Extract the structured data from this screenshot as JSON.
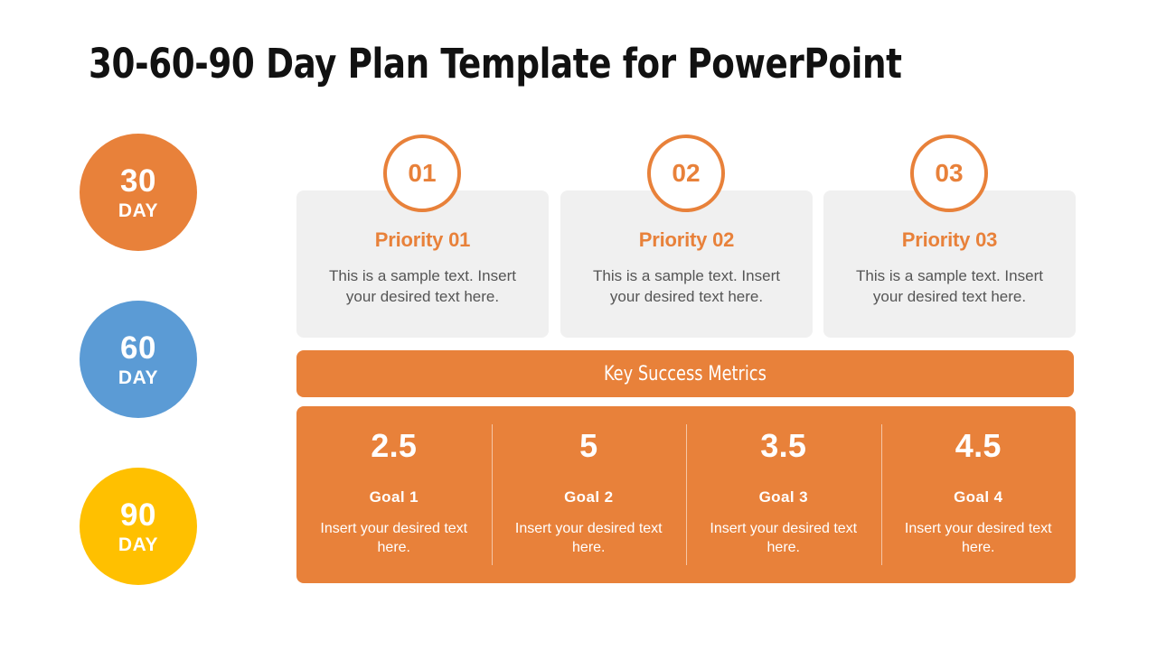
{
  "slide": {
    "title": "30-60-90 Day Plan Template for PowerPoint",
    "background_color": "#FFFFFF"
  },
  "colors": {
    "orange": "#E8813A",
    "blue": "#5B9BD5",
    "yellow": "#FFC000",
    "card_gray": "#F0F0F0",
    "body_text": "#555555",
    "title_text": "#111111"
  },
  "day_circles": [
    {
      "number": "30",
      "unit": "DAY",
      "color": "#E8813A"
    },
    {
      "number": "60",
      "unit": "DAY",
      "color": "#5B9BD5"
    },
    {
      "number": "90",
      "unit": "DAY",
      "color": "#FFC000"
    }
  ],
  "priorities": [
    {
      "badge": "01",
      "title": "Priority 01",
      "description": "This is a sample text. Insert your desired text here."
    },
    {
      "badge": "02",
      "title": "Priority 02",
      "description": "This is a sample text. Insert your desired text here."
    },
    {
      "badge": "03",
      "title": "Priority 03",
      "description": "This is a sample text. Insert your desired text here."
    }
  ],
  "metrics": {
    "header": "Key Success Metrics",
    "goals": [
      {
        "value": "2.5",
        "label": "Goal  1",
        "description": "Insert your desired text here."
      },
      {
        "value": "5",
        "label": "Goal  2",
        "description": "Insert your desired text here."
      },
      {
        "value": "3.5",
        "label": "Goal  3",
        "description": "Insert your desired text here."
      },
      {
        "value": "4.5",
        "label": "Goal  4",
        "description": "Insert your desired text here."
      }
    ]
  },
  "chart_data": {
    "type": "bar",
    "title": "Key Success Metrics",
    "categories": [
      "Goal  1",
      "Goal  2",
      "Goal  3",
      "Goal  4"
    ],
    "values": [
      2.5,
      5,
      3.5,
      4.5
    ],
    "xlabel": "",
    "ylabel": "",
    "ylim": [
      0,
      5
    ]
  }
}
